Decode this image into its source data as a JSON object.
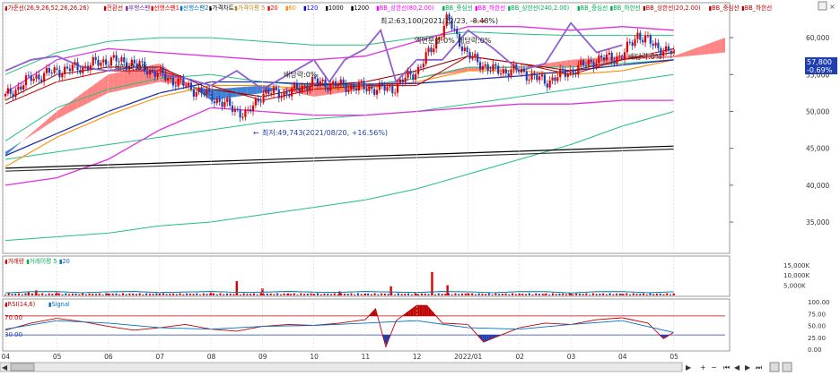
{
  "legend_price": [
    {
      "text": "가준선(26,9,26,52,26,26,26)",
      "color": "#c00000"
    },
    {
      "text": "전환선",
      "color": "#c00000"
    },
    {
      "text": "후행스팬",
      "color": "#7030a0"
    },
    {
      "text": "선행스팬1",
      "color": "#ff0000"
    },
    {
      "text": "선행스팬2",
      "color": "#0070c0"
    },
    {
      "text": "가격차트",
      "color": "#000000"
    },
    {
      "text": "가격이평 5",
      "color": "#b8860b"
    },
    {
      "text": "20",
      "color": "#ff0000"
    },
    {
      "text": "60",
      "color": "#ff8c00"
    },
    {
      "text": "120",
      "color": "#0000ff"
    },
    {
      "text": "1000",
      "color": "#000000"
    },
    {
      "text": "1200",
      "color": "#000000"
    },
    {
      "text": "BB_상한선(80,2.00)",
      "color": "#ff00ff"
    },
    {
      "text": "BB_중심선",
      "color": "#00b050"
    },
    {
      "text": "BB_하한선",
      "color": "#ff00ff"
    },
    {
      "text": "BB_상한선(240,2.00)",
      "color": "#00b050"
    },
    {
      "text": "BB_중심선",
      "color": "#00b050"
    },
    {
      "text": "BB_하한선",
      "color": "#00b050"
    },
    {
      "text": "BB_상한선(20,2.00)",
      "color": "#c00000"
    },
    {
      "text": "BB_중심선",
      "color": "#c00000"
    },
    {
      "text": "BB_하한선",
      "color": "#c00000"
    }
  ],
  "annotations": {
    "high": "최고:63,100(2021/12/23, -8.48%)",
    "low": "최저:49,743(2021/08/20, +16.56%)",
    "dividend_1": "배당락:0%",
    "dividend_2": "액면분할:0%",
    "dividend_3": "배당락:0%",
    "dividend_4": "배당락:0%",
    "dividend_5": "배당락:0%"
  },
  "price_tags": {
    "price": "57,800",
    "change": "-0.69%"
  },
  "volume_legend": [
    {
      "text": "거래량",
      "color": "#c00000"
    },
    {
      "text": "거래이평 5",
      "color": "#00b050"
    },
    {
      "text": "20",
      "color": "#0070c0"
    }
  ],
  "rsi_legend": [
    {
      "text": "RSI(14,6)",
      "color": "#c00000"
    },
    {
      "text": "Signal",
      "color": "#0070c0"
    }
  ],
  "rsi_level_labels": [
    "70.00",
    "30.00"
  ],
  "colors": {
    "up": "#e00000",
    "down": "#1f3fb0",
    "cloud_up": "#ff7070",
    "cloud_down": "#1e6fd0",
    "bb80": "#e030e0",
    "bb240": "#20c080",
    "bb20": "#c00000",
    "lagging": "#9060d0",
    "rsi_line": "#c00000",
    "signal_line": "#0070c0"
  },
  "chart_data": [
    {
      "type": "line",
      "title": "",
      "y_ticks": [
        "60,000",
        "55,000",
        "50,000",
        "45,000",
        "40,000",
        "35,000"
      ],
      "ylim": [
        31000,
        64500
      ],
      "x_tick_labels": [
        "04",
        "05",
        "06",
        "07",
        "08",
        "09",
        "10",
        "11",
        "12",
        "2022/01",
        "02",
        "03",
        "04",
        "05"
      ],
      "x_tick_months": [
        0,
        1,
        2,
        3,
        4,
        5,
        6,
        7,
        8,
        9,
        10,
        11,
        12,
        13
      ],
      "series": [
        {
          "key": "close",
          "months": [
            0.0,
            0.5,
            1.0,
            1.5,
            2.0,
            2.5,
            3.0,
            3.5,
            4.0,
            4.4,
            4.7,
            5.0,
            5.5,
            6.0,
            6.5,
            7.0,
            7.5,
            8.0,
            8.3,
            8.6,
            9.0,
            9.5,
            10.0,
            10.5,
            11.0,
            11.5,
            12.0,
            12.3,
            12.6,
            13.0
          ],
          "values": [
            52000,
            54500,
            55500,
            56000,
            57000,
            56500,
            55000,
            53500,
            52000,
            50500,
            49500,
            52500,
            52500,
            54000,
            53500,
            53200,
            53000,
            55500,
            58500,
            62500,
            57500,
            55500,
            55500,
            54000,
            55500,
            57000,
            57500,
            60500,
            59000,
            57800
          ]
        },
        {
          "key": "ma20",
          "months": [
            0,
            1,
            2,
            3,
            4,
            5,
            6,
            7,
            8,
            9,
            10,
            11,
            12,
            13
          ],
          "values": [
            51000,
            54000,
            55500,
            55500,
            53500,
            51500,
            53000,
            53500,
            53500,
            57500,
            56500,
            55000,
            57000,
            58500
          ]
        },
        {
          "key": "ma120",
          "months": [
            0,
            1,
            2,
            3,
            4,
            5,
            6,
            7,
            8,
            9,
            10,
            11,
            12,
            13
          ],
          "values": [
            44000,
            47000,
            50000,
            52500,
            54000,
            54000,
            53700,
            53700,
            53800,
            54300,
            54800,
            55500,
            56300,
            57000
          ]
        },
        {
          "key": "ma60",
          "months": [
            0,
            1,
            2,
            3,
            4,
            5,
            6,
            7,
            8,
            9,
            10,
            11,
            12,
            13
          ],
          "values": [
            42500,
            46500,
            49500,
            52000,
            53500,
            53500,
            53000,
            53200,
            54000,
            55500,
            55500,
            55000,
            55500,
            57000
          ]
        },
        {
          "key": "ma1000",
          "months": [
            0,
            13
          ],
          "values": [
            42300,
            45300
          ]
        },
        {
          "key": "ma1200",
          "months": [
            0,
            13
          ],
          "values": [
            41900,
            44900
          ]
        },
        {
          "key": "bb80_upper",
          "months": [
            0,
            1,
            2,
            3,
            4,
            5,
            6,
            7,
            8,
            9,
            10,
            11,
            12,
            13
          ],
          "values": [
            52500,
            57000,
            58500,
            58000,
            57500,
            57000,
            57000,
            57500,
            59500,
            61500,
            61500,
            61000,
            61500,
            61000
          ]
        },
        {
          "key": "bb80_mid",
          "months": [
            0,
            1,
            2,
            3,
            4,
            5,
            6,
            7,
            8,
            9,
            10,
            11,
            12,
            13
          ],
          "values": [
            46000,
            50500,
            53000,
            54500,
            55000,
            54000,
            53500,
            53500,
            54500,
            56000,
            56000,
            56000,
            56500,
            57000
          ]
        },
        {
          "key": "bb80_lower",
          "months": [
            0,
            1,
            2,
            3,
            4,
            5,
            6,
            7,
            8,
            9,
            10,
            11,
            12,
            13
          ],
          "values": [
            40000,
            41000,
            43500,
            47500,
            50500,
            50000,
            49500,
            49500,
            50000,
            50500,
            51000,
            51000,
            51500,
            51500
          ]
        },
        {
          "key": "bb240_upper",
          "months": [
            0,
            1,
            2,
            3,
            4,
            5,
            6,
            7,
            8,
            9,
            10,
            11,
            12,
            13
          ],
          "values": [
            55000,
            58000,
            59500,
            60000,
            60000,
            59500,
            59000,
            59000,
            60000,
            60800,
            60500,
            60300,
            60300,
            60300
          ]
        },
        {
          "key": "bb240_mid",
          "months": [
            0,
            1,
            2,
            3,
            4,
            5,
            6,
            7,
            8,
            9,
            10,
            11,
            12,
            13
          ],
          "values": [
            43500,
            44500,
            45500,
            46500,
            47500,
            48500,
            49000,
            49500,
            50000,
            51000,
            52000,
            53000,
            54000,
            55000
          ]
        },
        {
          "key": "bb240_lower",
          "months": [
            0,
            1,
            2,
            3,
            4,
            5,
            6,
            7,
            8,
            9,
            10,
            11,
            12,
            13
          ],
          "values": [
            32500,
            33000,
            33500,
            34500,
            35000,
            36000,
            37000,
            38000,
            39500,
            41500,
            43500,
            45500,
            48000,
            50000
          ]
        },
        {
          "key": "lagging",
          "months": [
            0.0,
            0.5,
            1.0,
            1.5,
            2.0,
            2.5,
            3.0,
            3.5,
            4.0,
            4.5,
            5.0,
            5.5,
            6.0,
            6.3,
            6.6,
            7.0,
            7.3,
            7.6,
            8.0,
            8.5,
            9.0,
            9.5,
            10.0,
            10.5,
            11.0,
            11.5,
            12.0
          ],
          "values": [
            55500,
            57000,
            57500,
            56000,
            55500,
            56000,
            55000,
            54500,
            53500,
            55500,
            53000,
            55000,
            57000,
            54000,
            57000,
            58500,
            61000,
            54000,
            57000,
            57000,
            61000,
            58500,
            55500,
            56500,
            62000,
            58000,
            59000
          ]
        }
      ],
      "cloud": {
        "months": [
          0,
          1,
          2,
          3,
          4,
          5,
          6,
          7,
          8,
          9,
          10,
          11,
          12,
          13,
          14
        ],
        "span1": [
          44000,
          50000,
          55000,
          56500,
          51500,
          52500,
          54000,
          53500,
          54500,
          56000,
          56000,
          57000,
          57500,
          57500,
          60000
        ],
        "span2": [
          44500,
          49000,
          52500,
          54000,
          53000,
          53500,
          52000,
          53000,
          54500,
          55500,
          56000,
          56000,
          57000,
          57300,
          58000
        ]
      },
      "ichimoku_base": {
        "months": [
          0,
          1,
          2,
          3,
          4,
          5,
          6,
          7,
          8,
          9,
          10,
          11,
          12,
          13
        ],
        "values": [
          51500,
          55000,
          56000,
          56000,
          53000,
          52000,
          53500,
          54000,
          55500,
          57500,
          56500,
          55500,
          57000,
          58000
        ]
      }
    },
    {
      "type": "bar",
      "title": "",
      "y_ticks": [
        "15,000K",
        "10,000K",
        "5,000K"
      ],
      "ylim": [
        0,
        18000
      ],
      "months": [
        0.45,
        0.6,
        1.0,
        2.0,
        3.0,
        4.0,
        4.5,
        5.0,
        5.5,
        6.0,
        6.5,
        7.0,
        7.5,
        8.0,
        8.3,
        8.6,
        9.0,
        10.0,
        10.5,
        11.0,
        12.0,
        13.0
      ],
      "values": [
        1500,
        2500,
        1500,
        1000,
        900,
        1400,
        7000,
        3500,
        1000,
        800,
        2000,
        900,
        4500,
        700,
        11500,
        5000,
        1200,
        800,
        600,
        900,
        800,
        700
      ]
    },
    {
      "type": "line",
      "title": "",
      "y_ticks": [
        "100.00",
        "75.00",
        "50.00",
        "25.00",
        "0.00"
      ],
      "ylim": [
        0,
        100
      ],
      "levels": [
        70,
        30
      ],
      "series": [
        {
          "key": "rsi",
          "months": [
            0.0,
            0.5,
            1.0,
            1.5,
            2.0,
            2.5,
            3.0,
            3.5,
            4.0,
            4.5,
            5.0,
            5.5,
            6.0,
            6.5,
            7.0,
            7.2,
            7.4,
            7.6,
            8.0,
            8.2,
            8.5,
            9.0,
            9.3,
            9.6,
            10.0,
            10.5,
            11.0,
            11.5,
            12.0,
            12.5,
            12.8,
            13.0
          ],
          "values": [
            40,
            55,
            65,
            58,
            48,
            40,
            45,
            52,
            42,
            38,
            48,
            52,
            50,
            55,
            62,
            85,
            5,
            60,
            92,
            92,
            55,
            52,
            15,
            28,
            45,
            55,
            52,
            62,
            66,
            55,
            22,
            35
          ]
        },
        {
          "key": "signal",
          "months": [
            0,
            1,
            2,
            3,
            4,
            5,
            6,
            7,
            8,
            9,
            10,
            11,
            12,
            13
          ],
          "values": [
            42,
            60,
            55,
            45,
            42,
            48,
            50,
            55,
            60,
            45,
            42,
            52,
            60,
            35
          ]
        }
      ]
    }
  ]
}
